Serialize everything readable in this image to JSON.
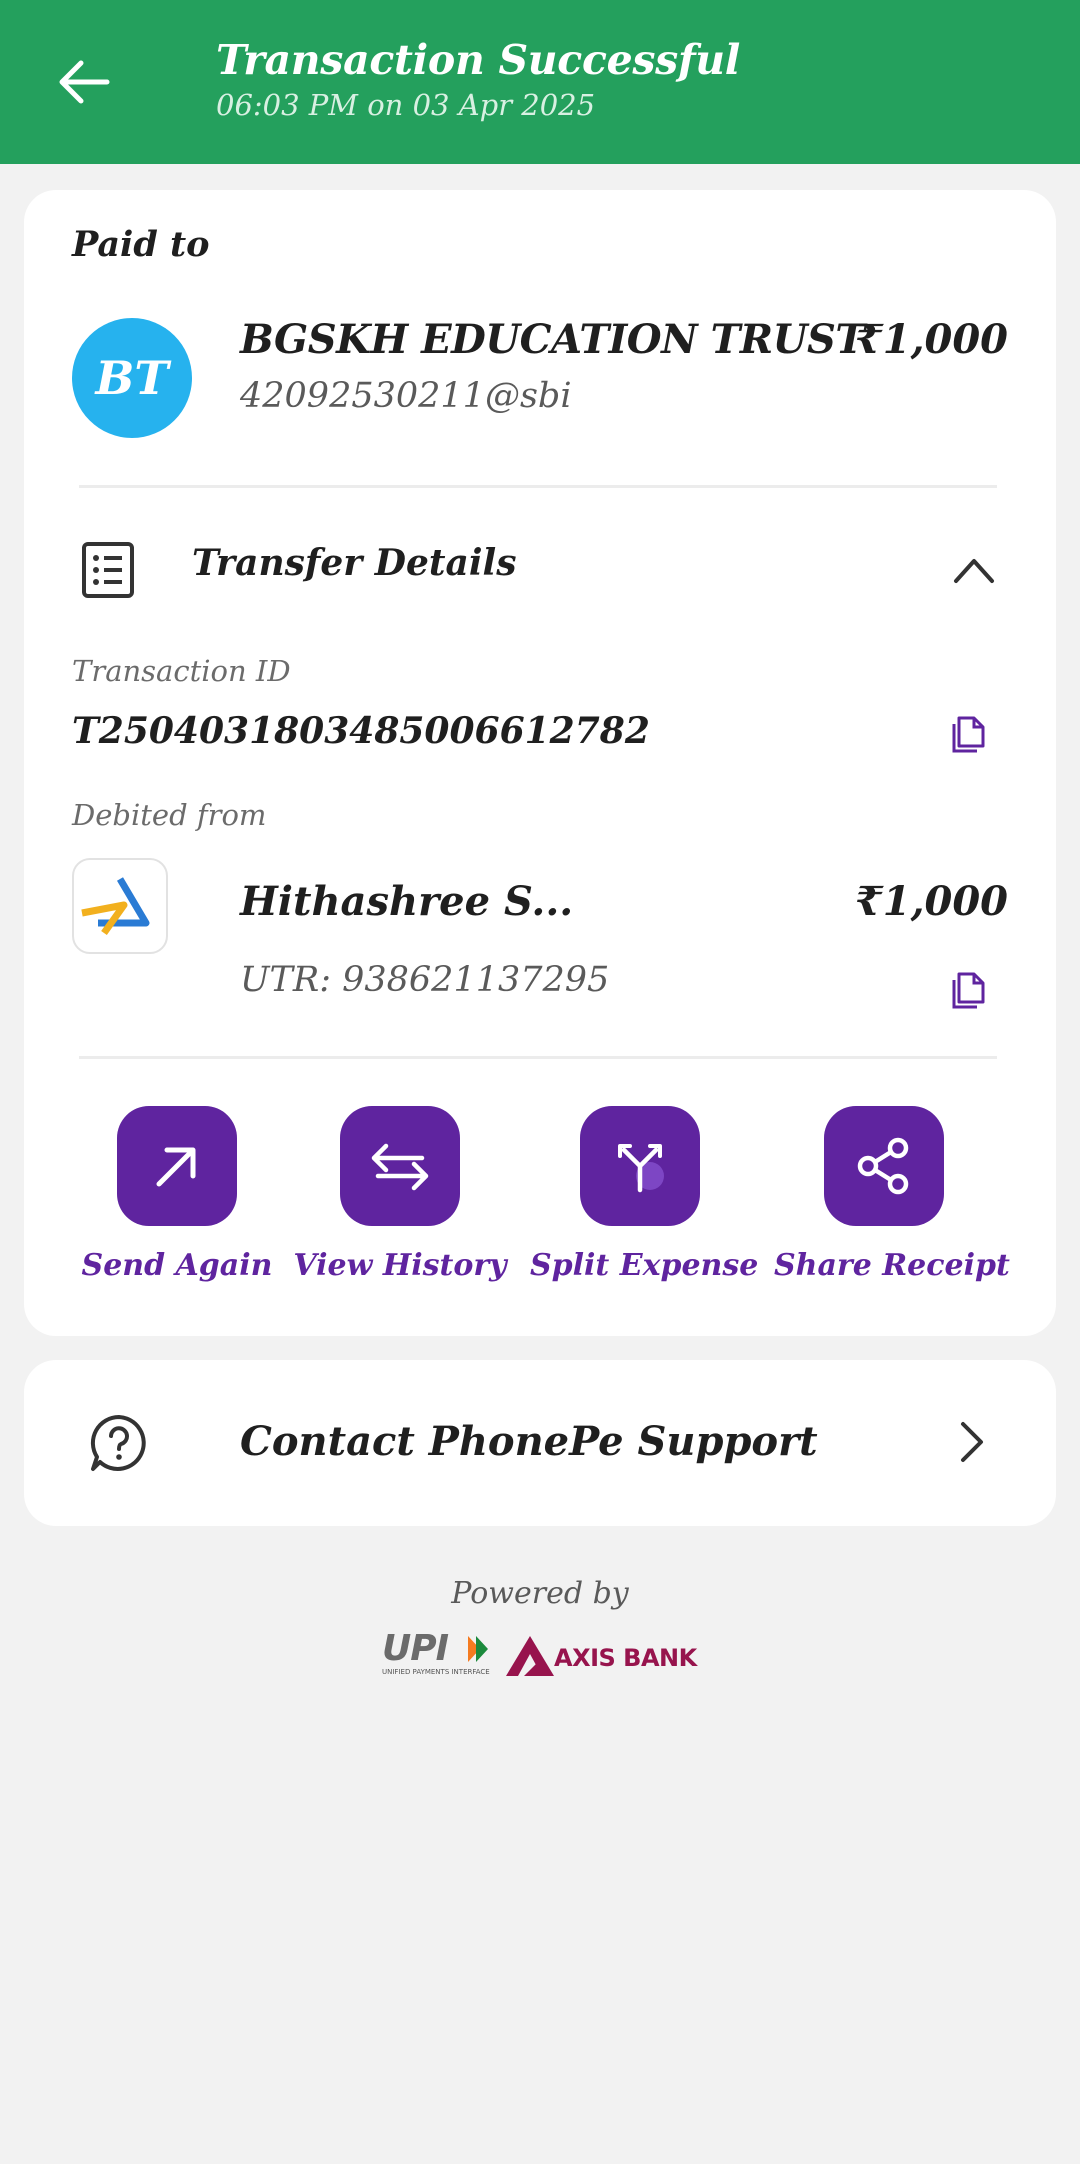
{
  "header": {
    "title": "Transaction Successful",
    "subtitle": "06:03 PM on 03 Apr 2025",
    "color": "#24a05d"
  },
  "payment": {
    "paid_to_label": "Paid to",
    "avatar_initials": "BT",
    "payee_name": "BGSKH EDUCATION TRUST",
    "payee_vpa": "42092530211@sbi",
    "amount": "₹1,000"
  },
  "transfer_details": {
    "title": "Transfer Details",
    "transaction_id_label": "Transaction ID",
    "transaction_id": "T2504031803485006612782",
    "debited_from_label": "Debited from",
    "account_name": "Hithashree S...",
    "account_amount": "₹1,000",
    "utr": "UTR: 938621137295"
  },
  "actions": [
    {
      "label": "Send Again",
      "icon": "arrow-up-right-icon"
    },
    {
      "label": "View History",
      "icon": "swap-arrows-icon"
    },
    {
      "label": "Split Expense",
      "icon": "split-icon"
    },
    {
      "label": "Share Receipt",
      "icon": "share-icon"
    }
  ],
  "support": {
    "label": "Contact PhonePe Support"
  },
  "footer": {
    "powered_by": "Powered by",
    "upi_text": "UPI",
    "upi_subtext": "UNIFIED PAYMENTS INTERFACE",
    "bank_text": "AXIS BANK"
  },
  "colors": {
    "accent": "#5f249f",
    "avatar": "#26b2ee",
    "axis": "#97144d"
  }
}
